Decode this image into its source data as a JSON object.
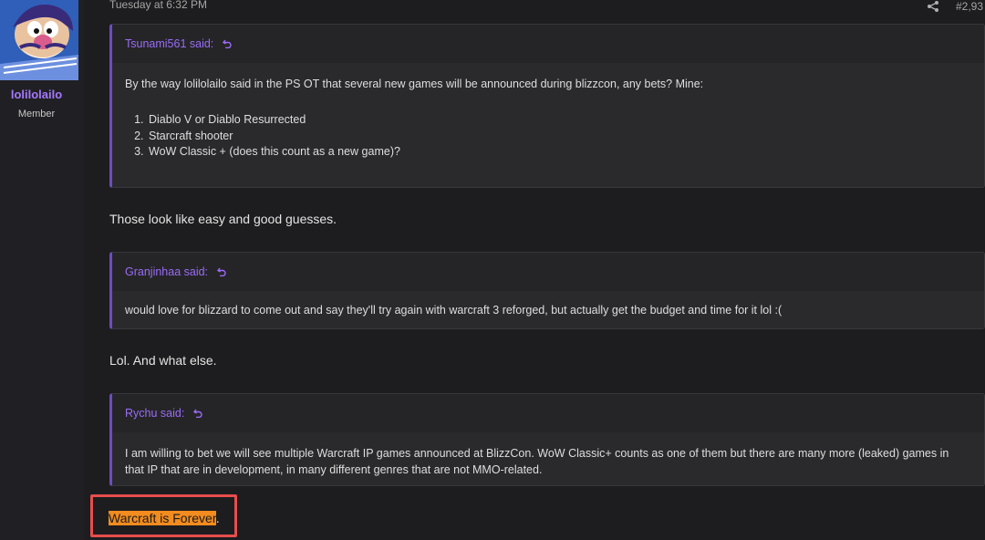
{
  "user": {
    "name": "lolilolailo",
    "title": "Member",
    "avatar_icon": "cartoon-character-avatar"
  },
  "post": {
    "date": "Tuesday at 6:32 PM",
    "number": "#2,93"
  },
  "quotes": [
    {
      "author": "Tsunami561 said:",
      "text": "By the way lolilolailo said in the PS OT that several new games will be announced during blizzcon, any bets? Mine:",
      "list": [
        "Diablo V or Diablo Resurrected",
        "Starcraft shooter",
        "WoW Classic + (does this count as a new game)?"
      ]
    },
    {
      "author": "Granjinhaa said:",
      "text": "would love for blizzard to come out and say they'll try again with warcraft 3 reforged, but actually get the budget and time for it lol :("
    },
    {
      "author": "Rychu said:",
      "text": "I am willing to bet we will see multiple Warcraft IP games announced at BlizzCon. WoW Classic+ counts as one of them but there are many more (leaked) games in that IP that are in development, in many different genres that are not MMO-related."
    }
  ],
  "replies": [
    "Those look like easy and good guesses.",
    "Lol. And what else."
  ],
  "final_reply": {
    "highlighted": "Warcraft is Forever",
    "trailing": "."
  },
  "colors": {
    "accent": "#9a6cf6",
    "highlight": "#f28c1f",
    "annotation_box": "#e84d4d"
  }
}
